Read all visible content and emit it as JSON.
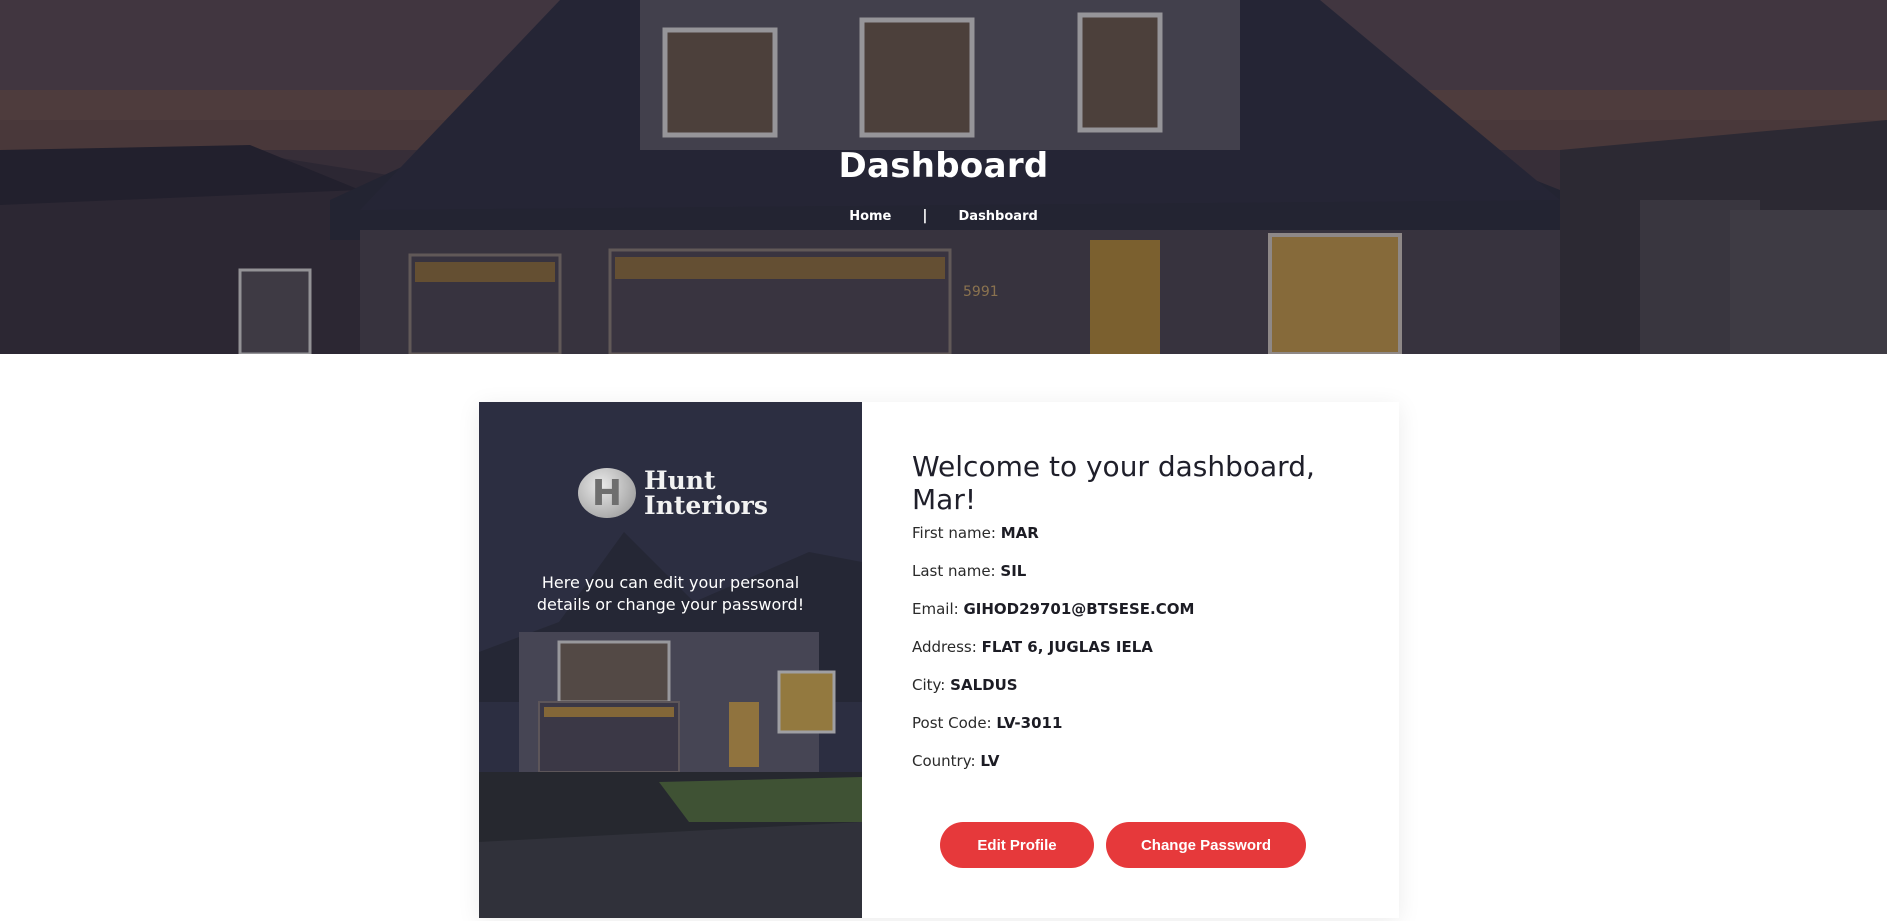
{
  "hero": {
    "title": "Dashboard",
    "breadcrumb": {
      "home": "Home",
      "separator": "|",
      "current": "Dashboard"
    },
    "house_number": "5991"
  },
  "sidebar": {
    "logo_icon_letter": "H",
    "logo_line1": "Hunt",
    "logo_line2": "Interiors",
    "caption": "Here you can edit your personal details or change your password!"
  },
  "profile": {
    "welcome": "Welcome to your dashboard, Mar!",
    "fields": [
      {
        "label": "First name:",
        "value": "MAR"
      },
      {
        "label": "Last name:",
        "value": "SIL"
      },
      {
        "label": "Email:",
        "value": "GIHOD29701@BTSESE.COM"
      },
      {
        "label": "Address:",
        "value": "FLAT 6, JUGLAS IELA"
      },
      {
        "label": "City:",
        "value": "SALDUS"
      },
      {
        "label": "Post Code:",
        "value": "LV-3011"
      },
      {
        "label": "Country:",
        "value": "LV"
      }
    ]
  },
  "actions": {
    "edit_profile": "Edit Profile",
    "change_password": "Change Password"
  },
  "colors": {
    "accent": "#e6393b",
    "text_dark": "#1f1f2a"
  }
}
